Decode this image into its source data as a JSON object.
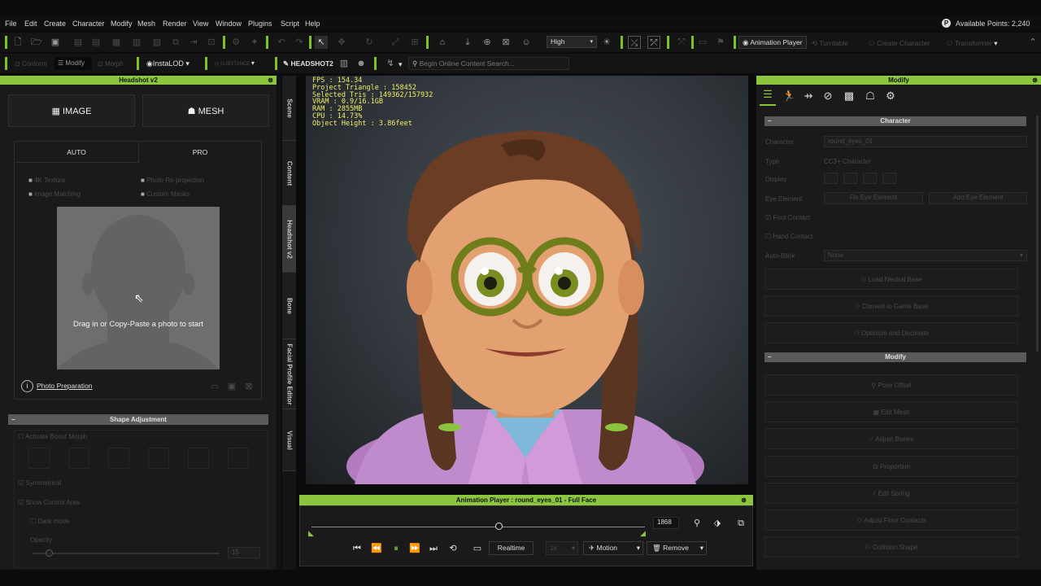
{
  "menu": [
    "File",
    "Edit",
    "Create",
    "Character",
    "Modify",
    "Mesh",
    "Render",
    "View",
    "Window",
    "Plugins",
    "Script",
    "Help"
  ],
  "points": {
    "label": "Available Points: 2,240"
  },
  "toolbar1": {
    "quality": "High",
    "animation_player": "Animation Player",
    "turntable": "Turntable",
    "create_character": "Create Character",
    "transformer": "Transformer"
  },
  "toolbar2": {
    "conform": "Conform",
    "modify": "Modify",
    "morph": "Morph",
    "instalod": "InstaLOD",
    "substance": "SUBSTANCE",
    "headshot": "HEADSHOT2",
    "search_placeholder": "Begin Online Content Search..."
  },
  "headshot_panel": {
    "title": "Headshot v2",
    "image": "IMAGE",
    "mesh": "MESH",
    "tab_auto": "AUTO",
    "tab_pro": "PRO",
    "opts": [
      "4K Texture",
      "Photo Re-projection",
      "Image Matching",
      "Custom Masks"
    ],
    "drop_text": "Drag in or Copy-Paste a photo to start",
    "photo_prep": "Photo Preparation",
    "shape_adj": "Shape Adjustment",
    "activate": "Activate Boost Morph",
    "symmetrical": "Symmetrical",
    "show_control": "Show Control Area",
    "dark_mode": "Dark mode",
    "opacity": "Opacity",
    "opacity_val": "15"
  },
  "side_tabs": [
    "Scene",
    "Content",
    "Headshot v2",
    "Bone",
    "Facial Profile Editor",
    "Visual"
  ],
  "viewport": {
    "stats": "FPS : 154.34\nProject Triangle : 158452\nSelected Tris : 149362/157932\nVRAM : 0.9/16.1GB\nRAM : 2855MB\nCPU : 14.73%\nObject Height : 3.86feet"
  },
  "modify_panel": {
    "title": "Modify",
    "character_hdr": "Character",
    "character_label": "Character",
    "character_val": "round_eyes_01",
    "type_label": "Type",
    "type_val": "CC3+ Character",
    "display_label": "Display",
    "eye_label": "Eye Element",
    "fix_eye": "Fix Eye Element",
    "add_eye": "Add Eye Element",
    "foot": "Foot Contact",
    "hand": "Hand Contact",
    "autoblink": "Auto-Blink",
    "autoblink_val": "None",
    "load_neutral": "Load Neutral Base",
    "convert": "Convert to Game Base",
    "optimize": "Optimize and Decimate",
    "modify_hdr": "Modify",
    "buttons": [
      "Pose Offset",
      "Edit Mesh",
      "Adjust Bones",
      "Proportion",
      "Edit Spring",
      "Adjust Floor Contacts",
      "Collision Shape"
    ]
  },
  "anim_player": {
    "title": "Animation Player : round_eyes_01 - Full Face",
    "frame": "1868",
    "realtime": "Realtime",
    "speed": "1x",
    "motion": "Motion",
    "remove": "Remove",
    "progress": 0.56
  }
}
